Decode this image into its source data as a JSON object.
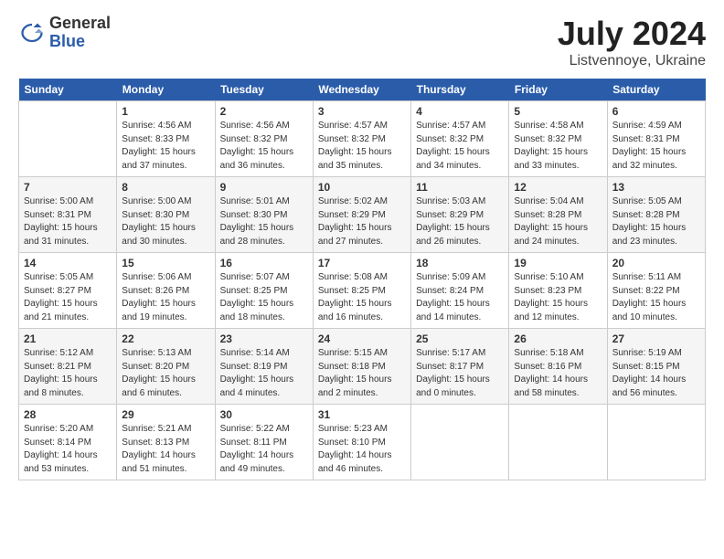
{
  "logo": {
    "general": "General",
    "blue": "Blue"
  },
  "title": "July 2024",
  "subtitle": "Listvennoye, Ukraine",
  "days_of_week": [
    "Sunday",
    "Monday",
    "Tuesday",
    "Wednesday",
    "Thursday",
    "Friday",
    "Saturday"
  ],
  "weeks": [
    [
      {
        "day": "",
        "info": ""
      },
      {
        "day": "1",
        "info": "Sunrise: 4:56 AM\nSunset: 8:33 PM\nDaylight: 15 hours\nand 37 minutes."
      },
      {
        "day": "2",
        "info": "Sunrise: 4:56 AM\nSunset: 8:32 PM\nDaylight: 15 hours\nand 36 minutes."
      },
      {
        "day": "3",
        "info": "Sunrise: 4:57 AM\nSunset: 8:32 PM\nDaylight: 15 hours\nand 35 minutes."
      },
      {
        "day": "4",
        "info": "Sunrise: 4:57 AM\nSunset: 8:32 PM\nDaylight: 15 hours\nand 34 minutes."
      },
      {
        "day": "5",
        "info": "Sunrise: 4:58 AM\nSunset: 8:32 PM\nDaylight: 15 hours\nand 33 minutes."
      },
      {
        "day": "6",
        "info": "Sunrise: 4:59 AM\nSunset: 8:31 PM\nDaylight: 15 hours\nand 32 minutes."
      }
    ],
    [
      {
        "day": "7",
        "info": "Sunrise: 5:00 AM\nSunset: 8:31 PM\nDaylight: 15 hours\nand 31 minutes."
      },
      {
        "day": "8",
        "info": "Sunrise: 5:00 AM\nSunset: 8:30 PM\nDaylight: 15 hours\nand 30 minutes."
      },
      {
        "day": "9",
        "info": "Sunrise: 5:01 AM\nSunset: 8:30 PM\nDaylight: 15 hours\nand 28 minutes."
      },
      {
        "day": "10",
        "info": "Sunrise: 5:02 AM\nSunset: 8:29 PM\nDaylight: 15 hours\nand 27 minutes."
      },
      {
        "day": "11",
        "info": "Sunrise: 5:03 AM\nSunset: 8:29 PM\nDaylight: 15 hours\nand 26 minutes."
      },
      {
        "day": "12",
        "info": "Sunrise: 5:04 AM\nSunset: 8:28 PM\nDaylight: 15 hours\nand 24 minutes."
      },
      {
        "day": "13",
        "info": "Sunrise: 5:05 AM\nSunset: 8:28 PM\nDaylight: 15 hours\nand 23 minutes."
      }
    ],
    [
      {
        "day": "14",
        "info": "Sunrise: 5:05 AM\nSunset: 8:27 PM\nDaylight: 15 hours\nand 21 minutes."
      },
      {
        "day": "15",
        "info": "Sunrise: 5:06 AM\nSunset: 8:26 PM\nDaylight: 15 hours\nand 19 minutes."
      },
      {
        "day": "16",
        "info": "Sunrise: 5:07 AM\nSunset: 8:25 PM\nDaylight: 15 hours\nand 18 minutes."
      },
      {
        "day": "17",
        "info": "Sunrise: 5:08 AM\nSunset: 8:25 PM\nDaylight: 15 hours\nand 16 minutes."
      },
      {
        "day": "18",
        "info": "Sunrise: 5:09 AM\nSunset: 8:24 PM\nDaylight: 15 hours\nand 14 minutes."
      },
      {
        "day": "19",
        "info": "Sunrise: 5:10 AM\nSunset: 8:23 PM\nDaylight: 15 hours\nand 12 minutes."
      },
      {
        "day": "20",
        "info": "Sunrise: 5:11 AM\nSunset: 8:22 PM\nDaylight: 15 hours\nand 10 minutes."
      }
    ],
    [
      {
        "day": "21",
        "info": "Sunrise: 5:12 AM\nSunset: 8:21 PM\nDaylight: 15 hours\nand 8 minutes."
      },
      {
        "day": "22",
        "info": "Sunrise: 5:13 AM\nSunset: 8:20 PM\nDaylight: 15 hours\nand 6 minutes."
      },
      {
        "day": "23",
        "info": "Sunrise: 5:14 AM\nSunset: 8:19 PM\nDaylight: 15 hours\nand 4 minutes."
      },
      {
        "day": "24",
        "info": "Sunrise: 5:15 AM\nSunset: 8:18 PM\nDaylight: 15 hours\nand 2 minutes."
      },
      {
        "day": "25",
        "info": "Sunrise: 5:17 AM\nSunset: 8:17 PM\nDaylight: 15 hours\nand 0 minutes."
      },
      {
        "day": "26",
        "info": "Sunrise: 5:18 AM\nSunset: 8:16 PM\nDaylight: 14 hours\nand 58 minutes."
      },
      {
        "day": "27",
        "info": "Sunrise: 5:19 AM\nSunset: 8:15 PM\nDaylight: 14 hours\nand 56 minutes."
      }
    ],
    [
      {
        "day": "28",
        "info": "Sunrise: 5:20 AM\nSunset: 8:14 PM\nDaylight: 14 hours\nand 53 minutes."
      },
      {
        "day": "29",
        "info": "Sunrise: 5:21 AM\nSunset: 8:13 PM\nDaylight: 14 hours\nand 51 minutes."
      },
      {
        "day": "30",
        "info": "Sunrise: 5:22 AM\nSunset: 8:11 PM\nDaylight: 14 hours\nand 49 minutes."
      },
      {
        "day": "31",
        "info": "Sunrise: 5:23 AM\nSunset: 8:10 PM\nDaylight: 14 hours\nand 46 minutes."
      },
      {
        "day": "",
        "info": ""
      },
      {
        "day": "",
        "info": ""
      },
      {
        "day": "",
        "info": ""
      }
    ]
  ]
}
